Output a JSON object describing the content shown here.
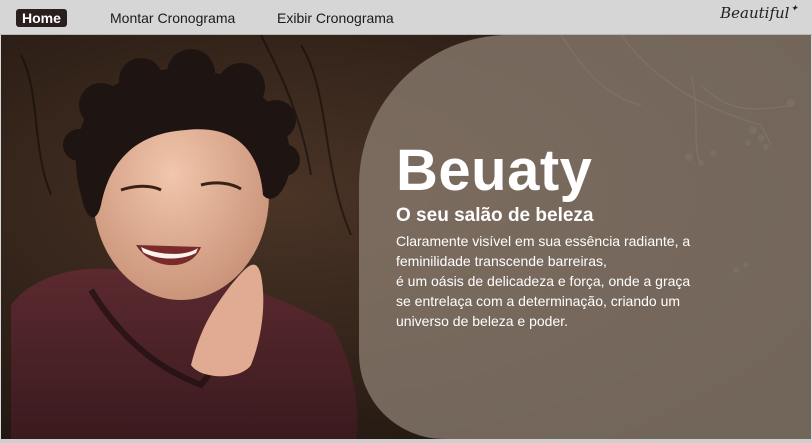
{
  "nav": {
    "home_label": "Home",
    "montar_label": "Montar Cronograma",
    "exibir_label": "Exibir Cronograma",
    "logo_text": "Beautiful",
    "logo_sparkle": "✦"
  },
  "hero": {
    "title": "Beuaty",
    "subtitle": "O seu salão de beleza",
    "body_lines": [
      "Claramente visível em sua essência radiante, a",
      "feminilidade transcende barreiras,",
      "é um oásis de delicadeza e força, onde a graça",
      "se entrelaça com a determinação, criando um",
      "universo de beleza e poder."
    ]
  }
}
